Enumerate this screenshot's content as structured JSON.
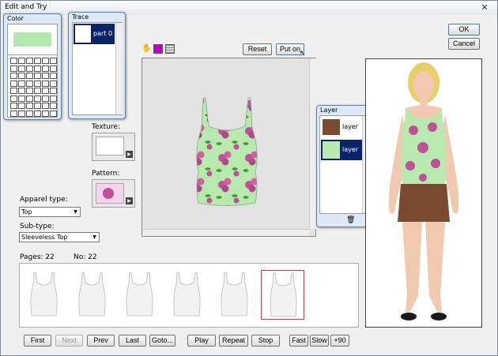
{
  "window": {
    "title": "Edit and Try",
    "close_glyph": "✕"
  },
  "buttons": {
    "ok": "OK",
    "cancel": "Cancel",
    "reset": "Reset",
    "put_on": "Put on"
  },
  "color_panel": {
    "title": "Color",
    "swatch_color": "#b3e8b0"
  },
  "trace_panel": {
    "title": "Trace",
    "item_label": "part 0"
  },
  "layer_panel": {
    "title": "Layer",
    "items": [
      {
        "label": "layer"
      },
      {
        "label": "layer"
      }
    ]
  },
  "labels": {
    "texture": "Texture:",
    "pattern": "Pattern:",
    "apparel_type": "Apparel type:",
    "sub_type": "Sub-type:",
    "pages": "Pages: 22",
    "no": "No: 22"
  },
  "apparel_type": {
    "value": "Top"
  },
  "sub_type": {
    "value": "Sleeveless Top"
  },
  "nav": {
    "first": "First",
    "next": "Next",
    "prev": "Prev",
    "last": "Last",
    "goto": "Goto..."
  },
  "playback": {
    "play": "Play",
    "repeat": "Repeat",
    "stop": "Stop",
    "fast": "Fast",
    "slow": "Slow",
    "rotate": "+90"
  },
  "colors": {
    "shirt_base": "#b8eab0",
    "flower": "#c0509a",
    "leaf": "#4c9a3a",
    "skirt": "#7a4a30",
    "selected_border": "#e03030",
    "selection_bg": "#0a246a"
  }
}
